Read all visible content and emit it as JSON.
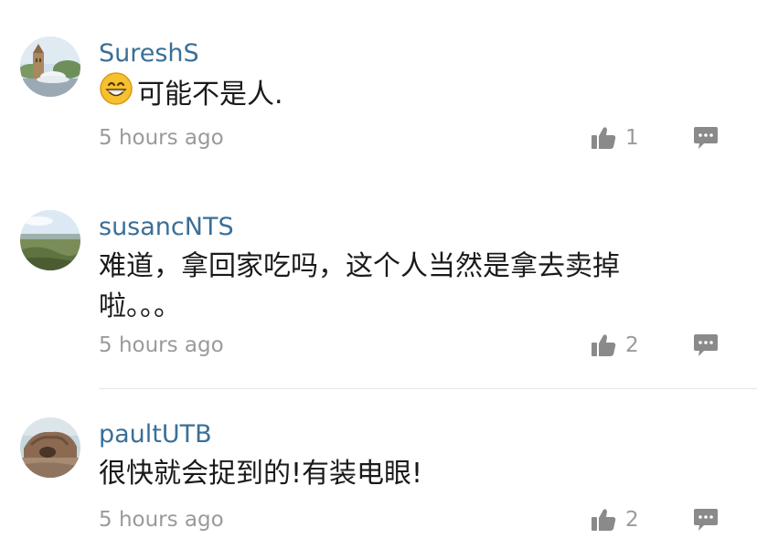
{
  "comments": [
    {
      "username": "SureshS",
      "text": "可能不是人.",
      "emoji": "grinning-face-emoji",
      "time": "5 hours ago",
      "likes": "1",
      "avatar": "tower-fountain-photo"
    },
    {
      "username": "susancNTS",
      "text": "难道，拿回家吃吗，这个人当然是拿去卖掉啦。。。",
      "time": "5 hours ago",
      "likes": "2",
      "avatar": "grassland-landscape-photo"
    },
    {
      "username": "paultUTB",
      "text": "很快就会捉到的!有装电眼!",
      "time": "5 hours ago",
      "likes": "2",
      "avatar": "rock-formation-photo"
    }
  ],
  "icons": {
    "like": "thumbs-up-icon",
    "reply": "speech-bubble-icon"
  },
  "colors": {
    "username": "#3a6f97",
    "meta": "#9a9a9a",
    "icon": "#8a8a8a"
  }
}
